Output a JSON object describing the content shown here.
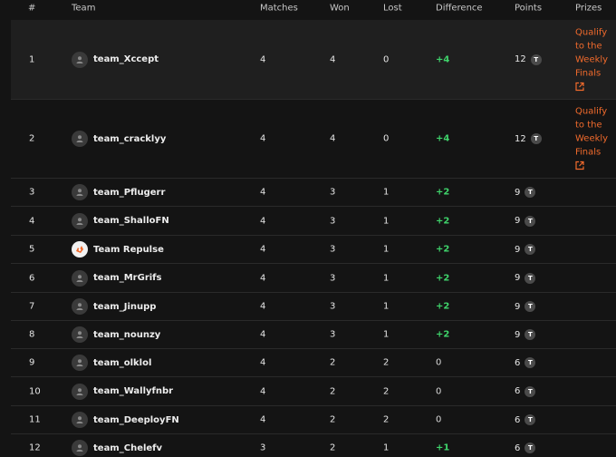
{
  "headers": {
    "rank": "#",
    "team": "Team",
    "matches": "Matches",
    "won": "Won",
    "lost": "Lost",
    "difference": "Difference",
    "points": "Points",
    "prizes": "Prizes"
  },
  "colors": {
    "accent": "#f06a2c",
    "positive": "#3fd46b",
    "background": "#141414",
    "highlight_row": "#1f1f1f"
  },
  "rows": [
    {
      "rank": "1",
      "team": "team_Xccept",
      "matches": "4",
      "won": "4",
      "lost": "0",
      "difference": "+4",
      "points": "12",
      "badge": "T",
      "prize": "Qualify to the Weekly Finals",
      "avatar_icon": "user-icon"
    },
    {
      "rank": "2",
      "team": "team_cracklyy",
      "matches": "4",
      "won": "4",
      "lost": "0",
      "difference": "+4",
      "points": "12",
      "badge": "T",
      "prize": "Qualify to the Weekly Finals",
      "avatar_icon": "user-icon"
    },
    {
      "rank": "3",
      "team": "team_Pflugerr",
      "matches": "4",
      "won": "3",
      "lost": "1",
      "difference": "+2",
      "points": "9",
      "badge": "T",
      "prize": "",
      "avatar_icon": "user-icon"
    },
    {
      "rank": "4",
      "team": "team_ShalloFN",
      "matches": "4",
      "won": "3",
      "lost": "1",
      "difference": "+2",
      "points": "9",
      "badge": "T",
      "prize": "",
      "avatar_icon": "user-icon"
    },
    {
      "rank": "5",
      "team": "Team Repulse",
      "matches": "4",
      "won": "3",
      "lost": "1",
      "difference": "+2",
      "points": "9",
      "badge": "T",
      "prize": "",
      "avatar_icon": "team-logo-icon"
    },
    {
      "rank": "6",
      "team": "team_MrGrifs",
      "matches": "4",
      "won": "3",
      "lost": "1",
      "difference": "+2",
      "points": "9",
      "badge": "T",
      "prize": "",
      "avatar_icon": "user-icon"
    },
    {
      "rank": "7",
      "team": "team_Jinupp",
      "matches": "4",
      "won": "3",
      "lost": "1",
      "difference": "+2",
      "points": "9",
      "badge": "T",
      "prize": "",
      "avatar_icon": "user-icon"
    },
    {
      "rank": "8",
      "team": "team_nounzy",
      "matches": "4",
      "won": "3",
      "lost": "1",
      "difference": "+2",
      "points": "9",
      "badge": "T",
      "prize": "",
      "avatar_icon": "user-icon"
    },
    {
      "rank": "9",
      "team": "team_olklol",
      "matches": "4",
      "won": "2",
      "lost": "2",
      "difference": "0",
      "points": "6",
      "badge": "T",
      "prize": "",
      "avatar_icon": "user-icon"
    },
    {
      "rank": "10",
      "team": "team_Wallyfnbr",
      "matches": "4",
      "won": "2",
      "lost": "2",
      "difference": "0",
      "points": "6",
      "badge": "T",
      "prize": "",
      "avatar_icon": "user-icon"
    },
    {
      "rank": "11",
      "team": "team_DeeployFN",
      "matches": "4",
      "won": "2",
      "lost": "2",
      "difference": "0",
      "points": "6",
      "badge": "T",
      "prize": "",
      "avatar_icon": "user-icon"
    },
    {
      "rank": "12",
      "team": "team_Chelefv",
      "matches": "3",
      "won": "2",
      "lost": "1",
      "difference": "+1",
      "points": "6",
      "badge": "T",
      "prize": "",
      "avatar_icon": "user-icon"
    }
  ]
}
